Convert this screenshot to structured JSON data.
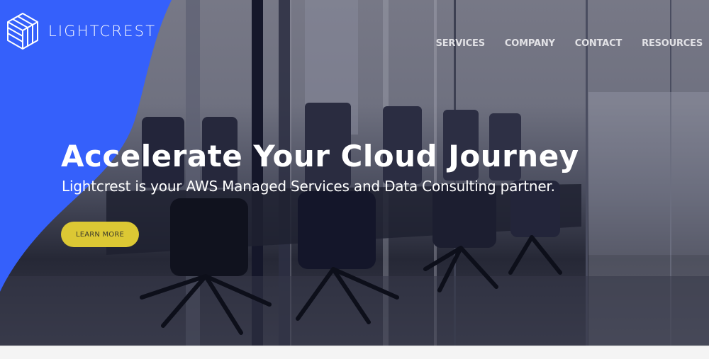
{
  "brand": {
    "name": "LIGHTCREST",
    "logo_icon": "cube-logo-icon",
    "accent_color": "#3560fb"
  },
  "nav": {
    "items": [
      {
        "label": "SERVICES"
      },
      {
        "label": "COMPANY"
      },
      {
        "label": "CONTACT"
      },
      {
        "label": "RESOURCES"
      }
    ]
  },
  "hero": {
    "headline": "Accelerate Your Cloud Journey",
    "subheadline": "Lightcrest is your AWS Managed Services and Data Consulting partner.",
    "cta_label": "LEARN MORE",
    "cta_color": "#dcc834",
    "background_image": "conference-room-photo"
  }
}
